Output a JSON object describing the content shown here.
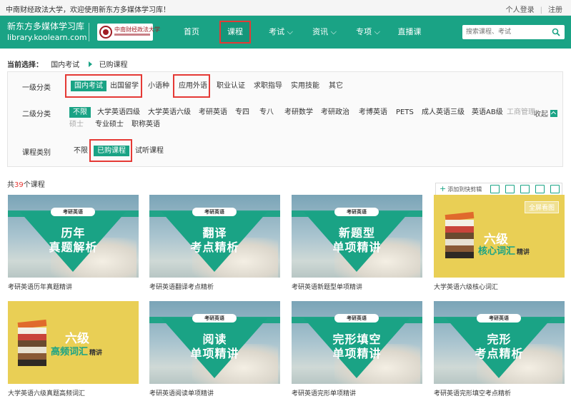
{
  "topbar": {
    "welcome": "中南财经政法大学，欢迎使用新东方多媒体学习库！",
    "login": "个人登录",
    "register": "注册"
  },
  "header": {
    "brand_title": "新东方多媒体学习库",
    "brand_url": "library.koolearn.com",
    "logo_text": "中南财经政法大学",
    "nav": [
      {
        "label": "首页"
      },
      {
        "label": "课程"
      },
      {
        "label": "考试 ⌵"
      },
      {
        "label": "资讯 ⌵"
      },
      {
        "label": "专项 ⌵"
      },
      {
        "label": "直播课"
      }
    ],
    "search_placeholder": "搜索课程、考试"
  },
  "breadcrumb": {
    "label": "当前选择：",
    "item1": "国内考试",
    "item2": "已购课程"
  },
  "filters": {
    "level1_label": "一级分类",
    "level1": [
      "国内考试",
      "出国留学",
      "小语种",
      "应用外语",
      "职业认证",
      "求职指导",
      "实用技能",
      "其它"
    ],
    "level2_label": "二级分类",
    "level2": [
      "不限",
      "大学英语四级",
      "大学英语六级",
      "考研英语",
      "专四",
      "专八",
      "考研数学",
      "考研政治",
      "考博英语",
      "PETS",
      "成人英语三级",
      "英语AB级",
      "工商管理",
      "硕士",
      "专业硕士",
      "职称英语"
    ],
    "collapse": "收起",
    "type_label": "课程类别",
    "types": [
      "不限",
      "已购课程",
      "试听课程"
    ]
  },
  "results": {
    "prefix": "共",
    "count": "39",
    "suffix": "个课程"
  },
  "toolbar": {
    "add_label": "添加到快剪辑"
  },
  "courses": [
    {
      "tag": "考研英语",
      "line1": "历年",
      "line2": "真题解析",
      "caption": "考研英语历年真题精讲"
    },
    {
      "tag": "考研英语",
      "line1": "翻译",
      "line2": "考点精析",
      "caption": "考研英语翻译考点精析"
    },
    {
      "tag": "考研英语",
      "line1": "新题型",
      "line2": "单项精讲",
      "caption": "考研英语新题型单项精讲"
    },
    {
      "y1": "六级",
      "y2": "核心词汇",
      "y3": "精讲",
      "fullview": "全屏看图",
      "caption": "大学英语六级核心词汇"
    },
    {
      "y1": "六级",
      "y2": "高频词汇",
      "y3": "精讲",
      "caption": "大学英语六级真题高频词汇"
    },
    {
      "tag": "考研英语",
      "line1": "阅读",
      "line2": "单项精讲",
      "caption": "考研英语阅读单项精讲"
    },
    {
      "tag": "考研英语",
      "line1": "完形填空",
      "line2": "单项精讲",
      "caption": "考研英语完形单项精讲"
    },
    {
      "tag": "考研英语",
      "line1": "完形",
      "line2": "考点精析",
      "caption": "考研英语完形填空考点精析"
    }
  ],
  "colors": {
    "brand": "#1aa385",
    "highlight": "#e53935",
    "count": "#e53935"
  }
}
